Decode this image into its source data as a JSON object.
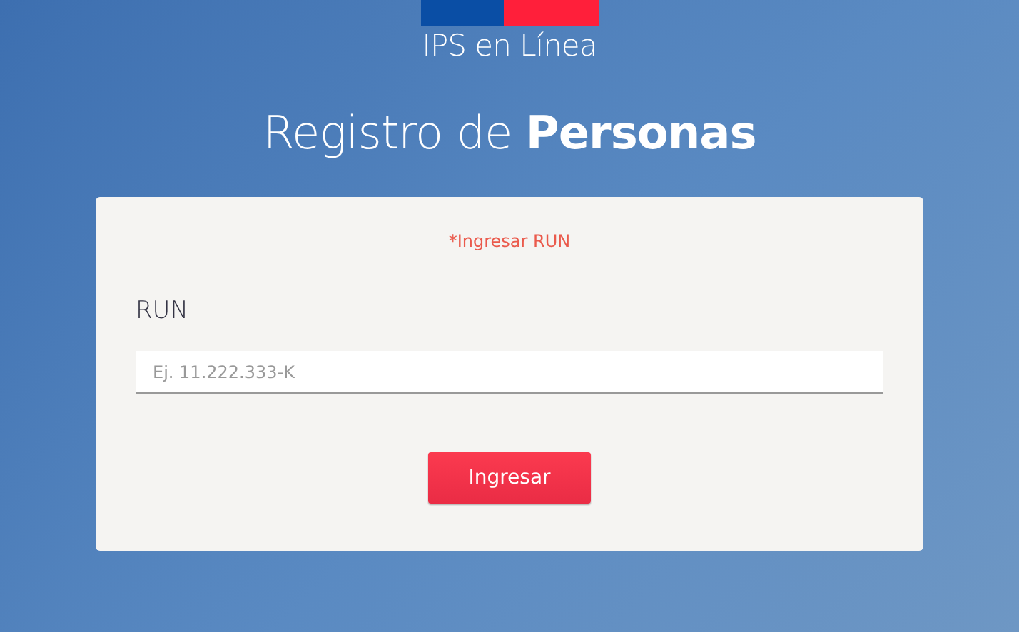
{
  "header": {
    "brand": "IPS en Línea",
    "title": "Registro de **Personas**"
  },
  "form": {
    "error": "*Ingresar RUN",
    "label": "RUN",
    "placeholder": "Ej. 11.222.333-K",
    "button": "Ingresar"
  }
}
